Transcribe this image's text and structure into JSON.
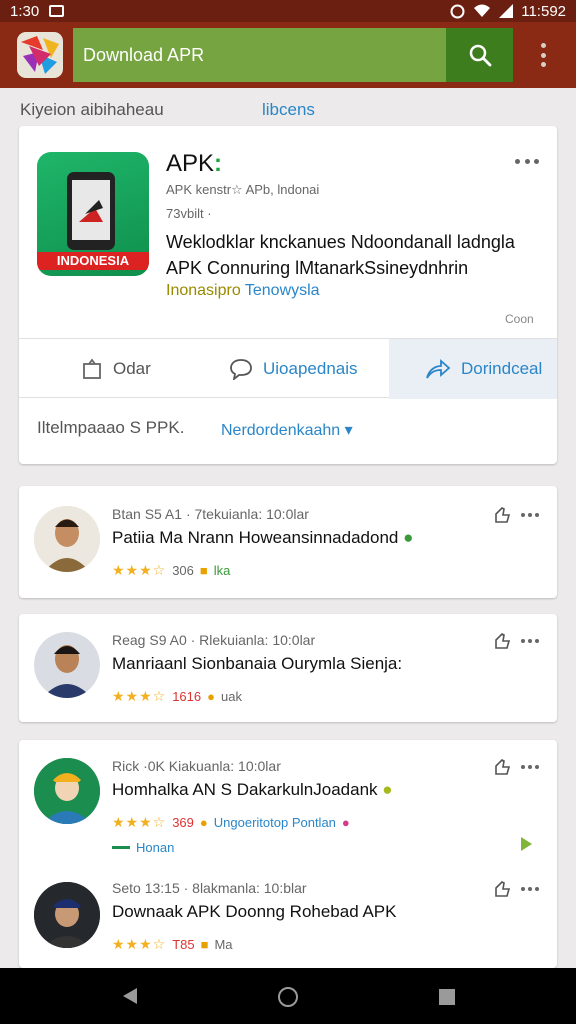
{
  "status_bar": {
    "time_left": "1:30",
    "time_right": "11:592"
  },
  "app_bar": {
    "search_text": "Download APR"
  },
  "subheader": {
    "left_text": "Kiyeion aibihaheau",
    "tab_text": "libcens"
  },
  "app_card": {
    "title": "APK",
    "title_dot": ":",
    "icon_badge": "INDONESIA",
    "meta_line1": "APK kenstr☆ APb, lndonai",
    "meta_line2": "73vbilt ·",
    "desc_line1": "Weklodklar knckanues Ndoondanall ladngla",
    "desc_line2": "APK Connuring lMtanarkSsineydnhrin",
    "desc_green": "Inonasipro",
    "desc_blue": "Tenowysla",
    "footer_text": "Coon",
    "actions": {
      "action1": "Odar",
      "action2": "Uioapednais",
      "action3": "Dorindceal"
    },
    "info_text": "Iltelmpaaao S PPK.",
    "info_link": "Nerdordenkaahn"
  },
  "reviews": [
    {
      "meta": "Btan S5 A1 · 7tekuianla: 10:0lar",
      "text": "Patiia Ma Nrann Howeansinnadadond",
      "rating": "306",
      "extra": "lka"
    },
    {
      "meta": "Reag S9 A0 · Rlekuianla: 10:0lar",
      "text": "Manriaanl Sionbanaia Ourymla Sienja:",
      "rating": "1616",
      "extra": "uak"
    },
    {
      "meta": "Rick ·0K Kiakuanla: 10:0lar",
      "text": "Homhalka AN S DakarkulnJoadank",
      "rating": "369",
      "extra": "Ungoeritotop Pontlan",
      "sub": "Honan"
    },
    {
      "meta": "Seto 13:15 · 8lakmanla: 10:blar",
      "text": "Downaak APK Doonng Rohebad APK",
      "rating": "T85",
      "extra": "Ma"
    }
  ],
  "colors": {
    "status_bar": "#6b1f10",
    "app_bar": "#8a2a15",
    "search_field": "#76a440",
    "search_button": "#3e7d1e",
    "accent_blue": "#2a86c8",
    "star": "#f2b01e"
  },
  "icons": [
    "search-icon",
    "overflow-menu-icon",
    "share-icon",
    "comment-icon",
    "download-icon",
    "thumbs-up-icon",
    "more-icon",
    "back-icon",
    "home-icon",
    "recents-icon"
  ]
}
